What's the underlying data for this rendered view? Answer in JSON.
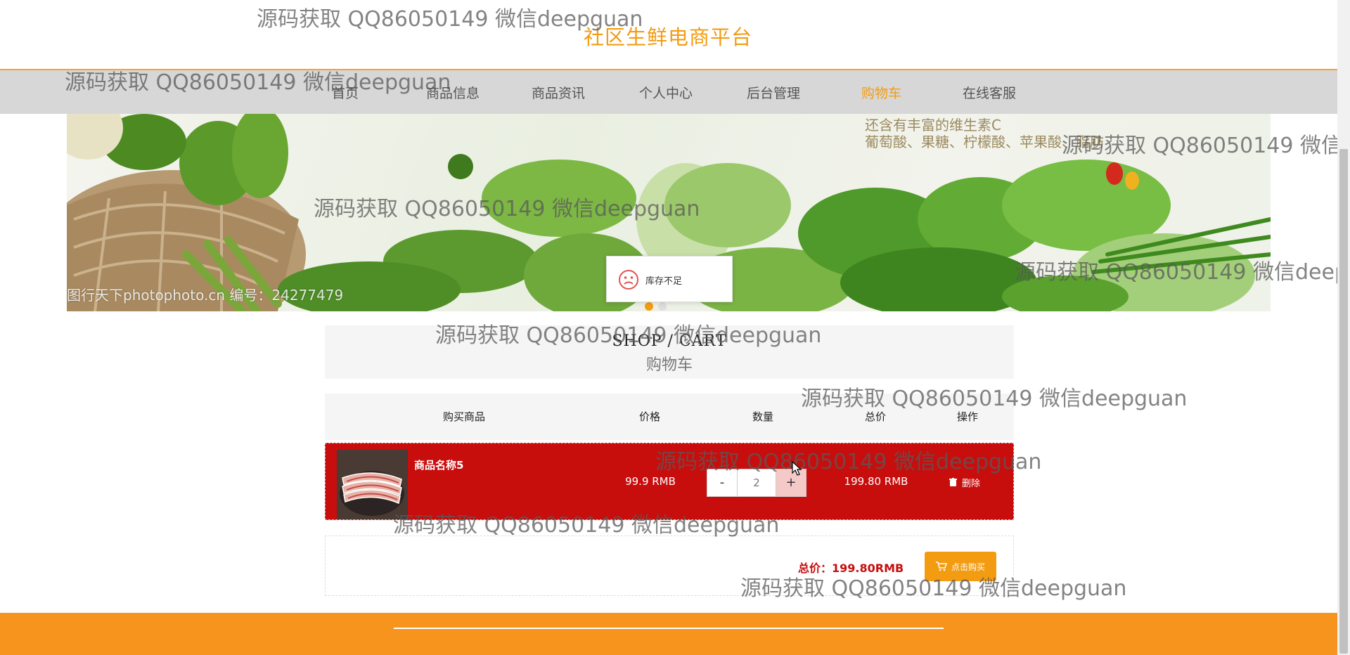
{
  "site": {
    "title": "社区生鲜电商平台"
  },
  "nav": {
    "items": [
      {
        "label": "首页",
        "active": false
      },
      {
        "label": "商品信息",
        "active": false
      },
      {
        "label": "商品资讯",
        "active": false
      },
      {
        "label": "个人中心",
        "active": false
      },
      {
        "label": "后台管理",
        "active": false
      },
      {
        "label": "购物车",
        "active": true
      },
      {
        "label": "在线客服",
        "active": false
      }
    ]
  },
  "banner": {
    "tagline_1": "还含有丰富的维生素C",
    "tagline_2": "葡萄酸、果糖、柠檬酸、苹果酸、脂肪",
    "credit": "图行天下photophoto.cn  编号：24277479",
    "slide_count": 2,
    "active_slide": 1
  },
  "toast": {
    "icon": "sad-face-icon",
    "message": "库存不足"
  },
  "cart": {
    "title_en": "SHOP / CART",
    "title_cn": "购物车",
    "columns": [
      "购买商品",
      "价格",
      "数量",
      "总价",
      "操作"
    ],
    "items": [
      {
        "name": "商品名称5",
        "price": "99.9 RMB",
        "quantity": "2",
        "total": "199.80 RMB",
        "delete_label": "删除"
      }
    ],
    "minus_label": "-",
    "plus_label": "+",
    "summary_label": "总价：199.80RMB",
    "buy_label": "点击购买"
  },
  "watermark_text": "源码获取 QQ86050149 微信deepguan",
  "colors": {
    "accent": "#f39c12",
    "row_highlight": "#c80d0d",
    "footer": "#f7941d",
    "nav_bg": "#d7d7d7"
  }
}
